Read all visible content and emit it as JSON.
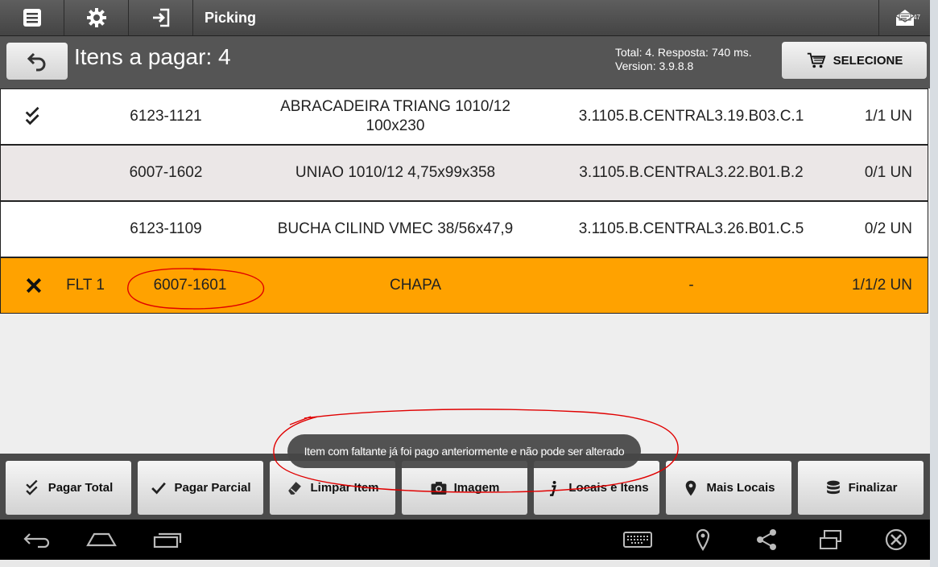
{
  "app": {
    "title": "Picking",
    "mail_count": "47"
  },
  "header": {
    "title": "Itens a pagar: 4",
    "info_line1": "Total: 4. Resposta: 740 ms.",
    "info_line2": "Version: 3.9.8.8",
    "select_label": "SELECIONE"
  },
  "rows": [
    {
      "status_icon": "double-check-icon",
      "flt": "",
      "code": "6123-1121",
      "desc_line1": "ABRACADEIRA TRIANG 1010/12",
      "desc_line2": "100x230",
      "location": "3.1105.B.CENTRAL3.19.B03.C.1",
      "qty": "1/1 UN"
    },
    {
      "status_icon": "",
      "flt": "",
      "code": "6007-1602",
      "desc_line1": "UNIAO 1010/12 4,75x99x358",
      "desc_line2": "",
      "location": "3.1105.B.CENTRAL3.22.B01.B.2",
      "qty": "0/1 UN"
    },
    {
      "status_icon": "",
      "flt": "",
      "code": "6123-1109",
      "desc_line1": "BUCHA CILIND VMEC 38/56x47,9",
      "desc_line2": "",
      "location": "3.1105.B.CENTRAL3.26.B01.C.5",
      "qty": "0/2 UN"
    },
    {
      "status_icon": "x-icon",
      "flt": "FLT 1",
      "code": "6007-1601",
      "desc_line1": "CHAPA",
      "desc_line2": "",
      "location": "-",
      "qty": "1/1/2 UN"
    }
  ],
  "toast": "Item com faltante já foi pago anteriormente e não pode ser alterado",
  "actions": {
    "pay_total": "Pagar Total",
    "pay_partial": "Pagar Parcial",
    "clear_item": "Limpar Item",
    "image": "Imagem",
    "locations_items": "Locais e Itens",
    "more_locations": "Mais Locais",
    "finish": "Finalizar"
  },
  "colors": {
    "highlight_row": "#ffa200",
    "annotation": "#e00000"
  }
}
